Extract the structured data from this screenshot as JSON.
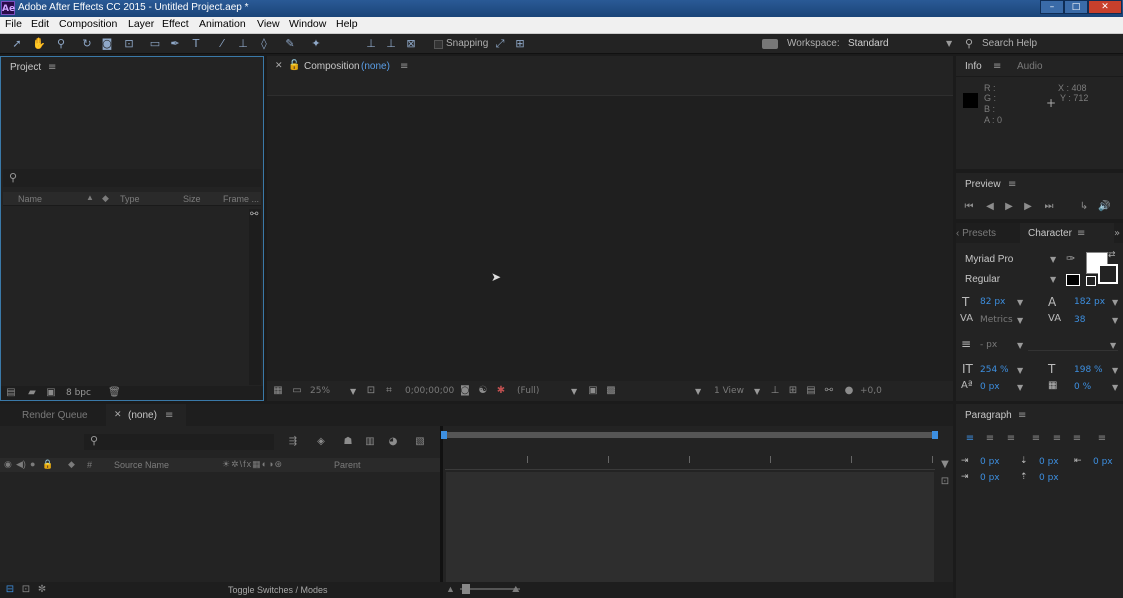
{
  "window": {
    "app_icon": "Ae",
    "title": "Adobe After Effects CC 2015 - Untitled Project.aep *",
    "controls": [
      "–",
      "□",
      "✕"
    ]
  },
  "menu": [
    "File",
    "Edit",
    "Composition",
    "Layer",
    "Effect",
    "Animation",
    "View",
    "Window",
    "Help"
  ],
  "toolbar": {
    "snapping_label": "Snapping",
    "workspace_label": "Workspace:",
    "workspace_value": "Standard",
    "search_help": "Search Help"
  },
  "project": {
    "title": "Project",
    "columns": [
      "Name",
      "Type",
      "Size",
      "Frame ..."
    ],
    "bpc": "8 bpc"
  },
  "composition": {
    "title": "Composition",
    "name": "(none)",
    "zoom": "25%",
    "timecode": "0;00;00;00",
    "resolution": "(Full)",
    "views": "1 View",
    "exposure": "+0,0"
  },
  "info": {
    "tab_info": "Info",
    "tab_audio": "Audio",
    "r": "R :",
    "g": "G :",
    "b": "B :",
    "a": "A : 0",
    "x": "X : 408",
    "y": "Y : 712"
  },
  "preview": {
    "title": "Preview"
  },
  "character": {
    "tab_presets": "‹ Presets",
    "tab_character": "Character",
    "font": "Myriad Pro",
    "style": "Regular",
    "size": "82 px",
    "leading": "182 px",
    "kerning": "Metrics",
    "tracking": "38",
    "stroke": "- px",
    "vscale": "254 %",
    "hscale": "198 %",
    "baseline": "0 px",
    "tsume": "0 %"
  },
  "paragraph": {
    "title": "Paragraph",
    "indent_left": "0 px",
    "space_before": "0 px",
    "indent_right": "0 px",
    "first_indent": "0 px",
    "space_after": "0 px"
  },
  "timeline": {
    "tab_render": "Render Queue",
    "tab_none": "(none)",
    "col_hash": "#",
    "col_source": "Source Name",
    "col_parent": "Parent",
    "toggle_label": "Toggle Switches / Modes"
  }
}
